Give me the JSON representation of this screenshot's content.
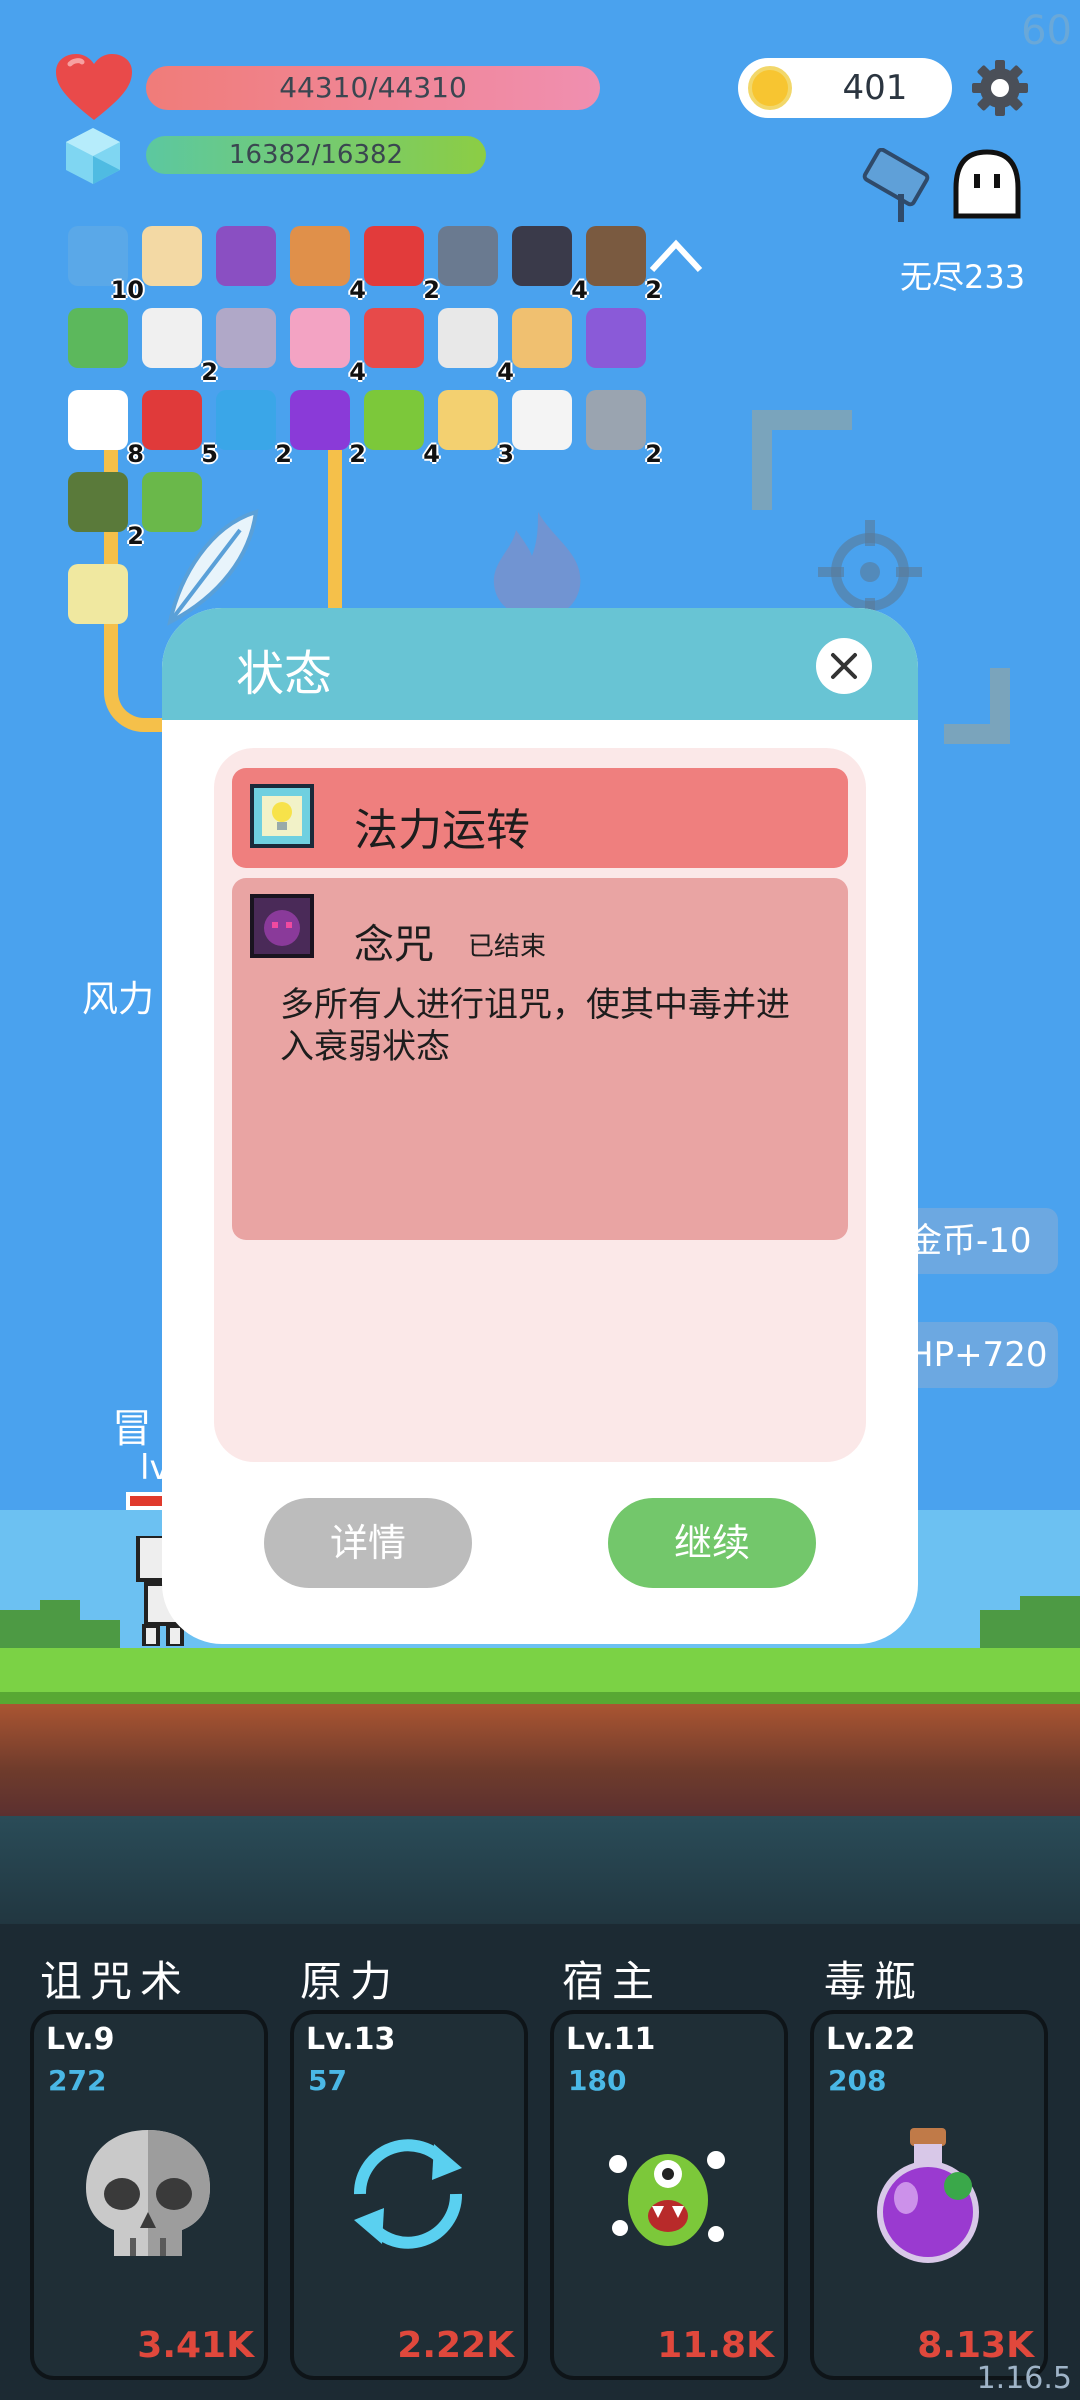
{
  "hud": {
    "fps": "60",
    "hp": "44310/44310",
    "mp": "16382/16382",
    "coins": "401",
    "endless_label": "无尽233",
    "version": "1.16.5"
  },
  "items": [
    {
      "icon": "star-card-icon",
      "count": "10",
      "color": "#5aa8e8"
    },
    {
      "icon": "treasure-map-icon",
      "count": "",
      "color": "#f3d9a4"
    },
    {
      "icon": "wizard-hat-icon",
      "count": "",
      "color": "#8a4fc2"
    },
    {
      "icon": "spell-book-icon",
      "count": "4",
      "color": "#e0904a"
    },
    {
      "icon": "apple-icon",
      "count": "2",
      "color": "#e23b3b"
    },
    {
      "icon": "mortar-icon",
      "count": "",
      "color": "#6a7a90"
    },
    {
      "icon": "bat-icon",
      "count": "4",
      "color": "#3a3a4a"
    },
    {
      "icon": "coconut-icon",
      "count": "2",
      "color": "#7a5a40"
    },
    {
      "icon": "green-card-icon",
      "count": "",
      "color": "#5cb85c"
    },
    {
      "icon": "ghost-icon",
      "count": "2",
      "color": "#f0f0f0"
    },
    {
      "icon": "unicorn-icon",
      "count": "",
      "color": "#b0a8c8"
    },
    {
      "icon": "ice-cream-icon",
      "count": "4",
      "color": "#f3a3c3"
    },
    {
      "icon": "pill-icon",
      "count": "",
      "color": "#e74a4a"
    },
    {
      "icon": "playing-cards-icon",
      "count": "4",
      "color": "#e8e8e8"
    },
    {
      "icon": "scroll-icon",
      "count": "",
      "color": "#f0c070"
    },
    {
      "icon": "gift-box-icon",
      "count": "",
      "color": "#8a5ad8"
    },
    {
      "icon": "fried-egg-icon",
      "count": "8",
      "color": "#fff"
    },
    {
      "icon": "mushroom-icon",
      "count": "5",
      "color": "#e03a3a"
    },
    {
      "icon": "speech-bubble-icon",
      "count": "2",
      "color": "#3aa6e8"
    },
    {
      "icon": "crystal-ball-icon",
      "count": "2",
      "color": "#8a3ad8"
    },
    {
      "icon": "lime-icon",
      "count": "4",
      "color": "#7cc83a"
    },
    {
      "icon": "map-pencil-icon",
      "count": "3",
      "color": "#f3d070"
    },
    {
      "icon": "envelope-icon",
      "count": "",
      "color": "#f4f4f4"
    },
    {
      "icon": "compass-icon",
      "count": "2",
      "color": "#9aa4b0"
    },
    {
      "icon": "grenade-icon",
      "count": "2",
      "color": "#5a7a3a"
    },
    {
      "icon": "goblin-icon",
      "count": "",
      "color": "#6ab84a"
    },
    {
      "icon": "lightbulb-tile-icon",
      "count": "",
      "color": "#f0e8a0"
    }
  ],
  "battle": {
    "wind_label": "风力",
    "gold_change": "金币-10",
    "hp_change": "HP+720",
    "adventurer_label": "冒",
    "adventurer_lv": "lv"
  },
  "dialog": {
    "title": "状态",
    "status1": {
      "name": "法力运转"
    },
    "status2": {
      "name": "念咒",
      "state": "已结束",
      "description": "多所有人进行诅咒，使其中毒并进入衰弱状态"
    },
    "detail_button": "详情",
    "continue_button": "继续"
  },
  "skills": [
    {
      "name": "诅咒术",
      "level": "Lv.9",
      "value": "272",
      "cost": "3.41K",
      "icon": "skull-icon"
    },
    {
      "name": "原力",
      "level": "Lv.13",
      "value": "57",
      "cost": "2.22K",
      "icon": "cycle-arrows-icon"
    },
    {
      "name": "宿主",
      "level": "Lv.11",
      "value": "180",
      "cost": "11.8K",
      "icon": "green-monster-icon"
    },
    {
      "name": "毒瓶",
      "level": "Lv.22",
      "value": "208",
      "cost": "8.13K",
      "icon": "poison-bottle-icon"
    }
  ],
  "colors": {
    "sky": "#4aa2ee",
    "hp_bar": "#f07c79",
    "mp_bar": "#8ccd44",
    "dialog_header": "#68c4d4",
    "active_status": "#ef7f7e",
    "ended_status": "#e9a4a3",
    "continue_button": "#73c76b",
    "cost_text": "#e0483c"
  }
}
